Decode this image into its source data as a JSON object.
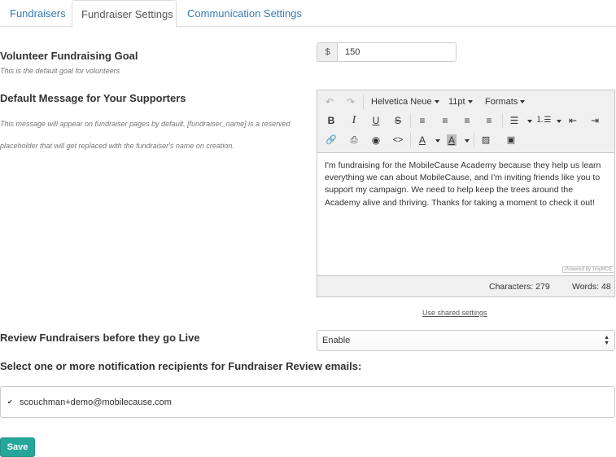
{
  "tabs": [
    {
      "label": "Fundraisers",
      "active": false
    },
    {
      "label": "Fundraiser Settings",
      "active": true
    },
    {
      "label": "Communication Settings",
      "active": false
    }
  ],
  "goal": {
    "label": "Volunteer Fundraising Goal",
    "help": "This is the default goal for volunteers",
    "currency_symbol": "$",
    "value": "150"
  },
  "message": {
    "label": "Default Message for Your Supporters",
    "help_line1": "This message will appear on fundraiser pages by default. [fundraiser_name] is a reserved",
    "help_line2": "placeholder that will get replaced with the fundraiser's name on creation.",
    "editor": {
      "font_family": "Helvetica Neue",
      "font_size": "11pt",
      "formats_label": "Formats",
      "content_lines": [
        "I'm fundraising for the MobileCause Academy because they help us learn",
        "everything we can about MobileCause, and I'm inviting friends like you to",
        "support my campaign. We need to help keep the trees around the",
        "Academy alive and thriving. Thanks for taking a moment to check it out!"
      ],
      "powered_by": "Powered by TinyMCE",
      "characters": "Characters: 279",
      "words": "Words: 48"
    },
    "shared_link": "Use shared settings"
  },
  "review": {
    "label": "Review Fundraisers before they go Live",
    "selected": "Enable"
  },
  "recipients": {
    "label": "Select one or more notification recipients for Fundraiser Review emails:",
    "items": [
      {
        "email": "scouchman+demo@mobilecause.com",
        "checked": true
      }
    ]
  },
  "save_label": "Save",
  "colors": {
    "accent": "#26a69a",
    "link": "#337ab7"
  }
}
